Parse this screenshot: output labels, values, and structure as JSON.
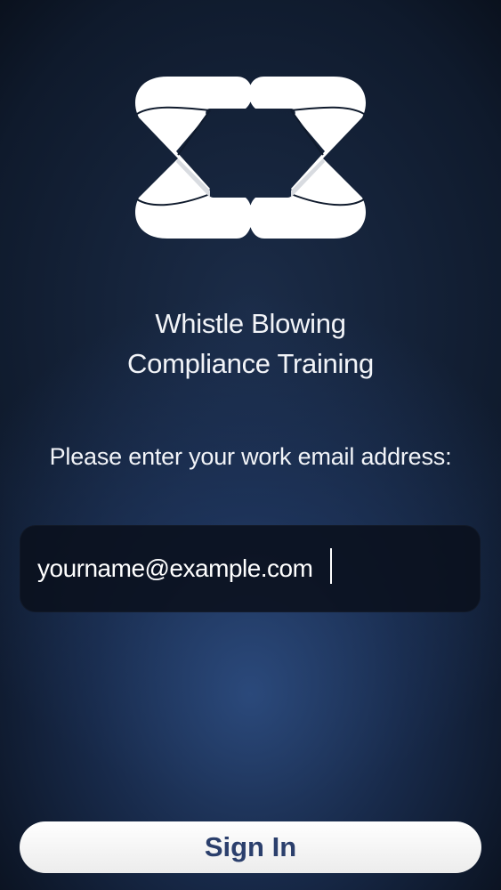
{
  "app": {
    "title_line_1": "Whistle Blowing",
    "title_line_2": "Compliance Training",
    "logo_icon": "sigma-ribbon-logo-icon"
  },
  "login": {
    "prompt": "Please enter your work email address:",
    "email_value": "yourname@example.com",
    "email_placeholder": "",
    "sign_in_label": "Sign In"
  },
  "colors": {
    "background_dark": "#0f1a2c",
    "background_glow": "#30528a",
    "field_background": "#0a101c",
    "button_background": "#ffffff",
    "button_text": "#2b3f6c",
    "text": "#f2f4f8"
  }
}
